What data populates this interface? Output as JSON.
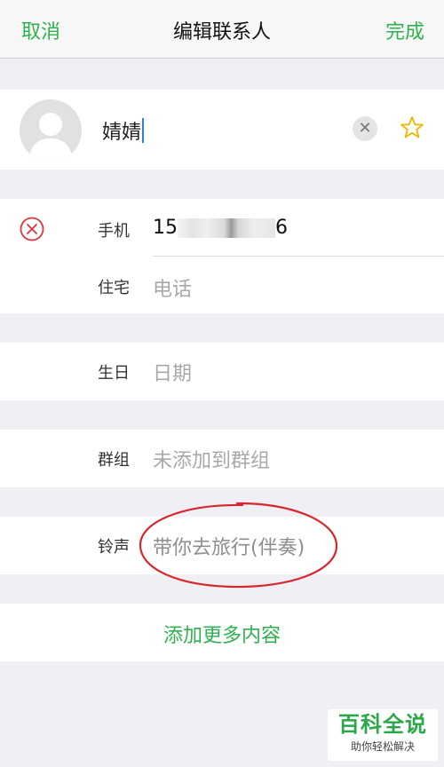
{
  "topbar": {
    "cancel_label": "取消",
    "title": "编辑联系人",
    "done_label": "完成"
  },
  "contact": {
    "name": "婧婧",
    "clear_icon": "close-icon",
    "favorite_icon": "star-outline-icon"
  },
  "phone": {
    "label": "手机",
    "value_prefix": "15",
    "value_suffix": "6",
    "remove_icon": "remove-circle-icon"
  },
  "home": {
    "label": "住宅",
    "placeholder": "电话"
  },
  "birthday": {
    "label": "生日",
    "placeholder": "日期"
  },
  "group": {
    "label": "群组",
    "value": "未添加到群组"
  },
  "ringtone": {
    "label": "铃声",
    "value": "带你去旅行(伴奏)"
  },
  "add_more_label": "添加更多内容",
  "watermark": {
    "main": "百科全说",
    "sub": "助你轻松解决"
  },
  "colors": {
    "accent": "#2fb14f",
    "annotation": "#d8262e",
    "background": "#efeff4"
  }
}
